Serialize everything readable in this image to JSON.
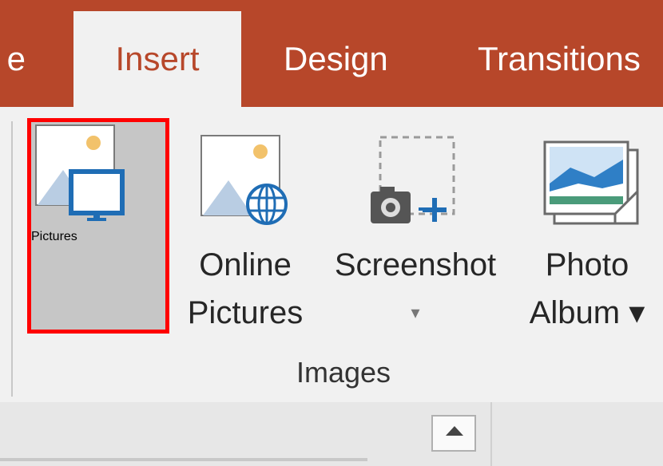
{
  "tabs": {
    "home_partial": "e",
    "insert": "Insert",
    "design": "Design",
    "transitions": "Transitions"
  },
  "images_group": {
    "label": "Images",
    "pictures": {
      "line1": "Pictures"
    },
    "online_pictures": {
      "line1": "Online",
      "line2": "Pictures"
    },
    "screenshot": {
      "line1": "Screenshot",
      "dropdown": "▾"
    },
    "photo_album": {
      "line1": "Photo",
      "line2": "Album ▾"
    }
  },
  "colors": {
    "tab_bar": "#b7472a",
    "ribbon": "#f1f1f1",
    "highlight_border": "#ff0000",
    "selected_button": "#c6c6c6"
  },
  "icons": {
    "pictures": "image-on-monitor-icon",
    "online_pictures": "image-with-globe-icon",
    "screenshot": "camera-plus-icon",
    "photo_album": "photo-stack-icon",
    "collapse": "collapse-ribbon-triangle-icon"
  }
}
